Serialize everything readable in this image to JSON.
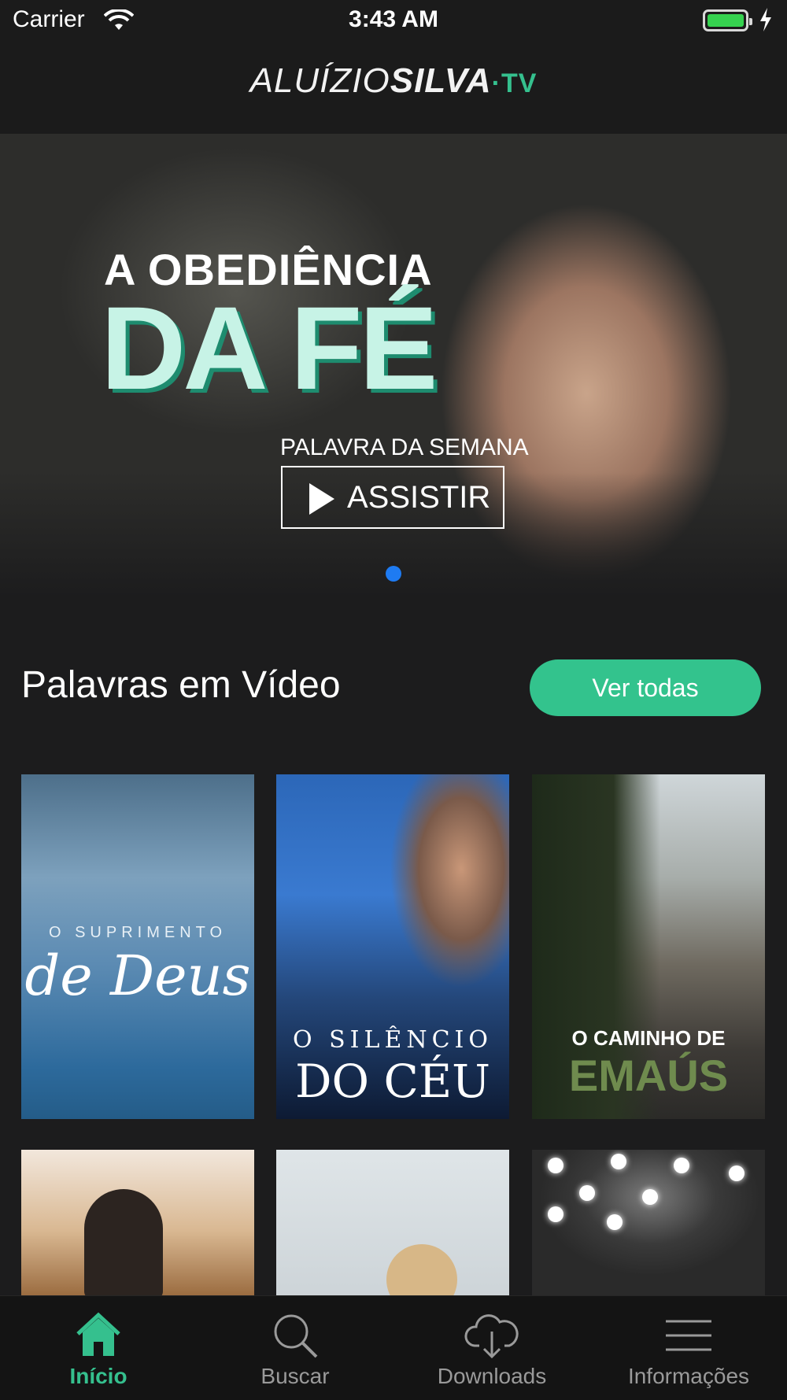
{
  "status_bar": {
    "carrier": "Carrier",
    "time": "3:43 AM"
  },
  "header": {
    "logo_thin": "ALUÍZIO",
    "logo_bold": "SILVA",
    "logo_tv": "·TV"
  },
  "hero": {
    "title_line1": "A OBEDIÊNCIA",
    "title_line2": "DA FÉ",
    "subtitle": "PALAVRA DA SEMANA",
    "button_label": "ASSISTIR",
    "page_indicator": "1"
  },
  "section": {
    "title": "Palavras em Vídeo",
    "see_all_label": "Ver todas"
  },
  "videos": [
    {
      "title_top": "O SUPRIMENTO",
      "title_bottom": "de Deus"
    },
    {
      "title_top": "O SILÊNCIO",
      "title_bottom": "DO CÉU"
    },
    {
      "title_top": "O CAMINHO DE",
      "title_bottom": "EMAÚS"
    }
  ],
  "tabs": [
    {
      "label": "Início",
      "icon": "home-icon",
      "active": true
    },
    {
      "label": "Buscar",
      "icon": "search-icon",
      "active": false
    },
    {
      "label": "Downloads",
      "icon": "cloud-download-icon",
      "active": false
    },
    {
      "label": "Informações",
      "icon": "menu-icon",
      "active": false
    }
  ],
  "colors": {
    "accent": "#33c38d",
    "page_indicator": "#1e7bf2",
    "background": "#1c1c1d"
  }
}
